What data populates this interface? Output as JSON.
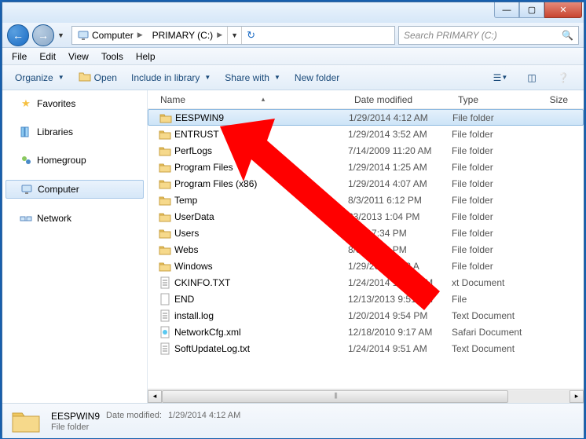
{
  "window_controls": {
    "min": "—",
    "max": "▢",
    "close": "✕"
  },
  "nav": {
    "back": "←",
    "forward": "→"
  },
  "breadcrumbs": [
    "Computer",
    "PRIMARY (C:)"
  ],
  "search": {
    "placeholder": "Search PRIMARY (C:)"
  },
  "menubar": [
    "File",
    "Edit",
    "View",
    "Tools",
    "Help"
  ],
  "toolbar": {
    "organize": "Organize",
    "open": "Open",
    "include": "Include in library",
    "share": "Share with",
    "newfolder": "New folder"
  },
  "sidebar": {
    "favorites": "Favorites",
    "libraries": "Libraries",
    "homegroup": "Homegroup",
    "computer": "Computer",
    "network": "Network"
  },
  "columns": {
    "name": "Name",
    "date": "Date modified",
    "type": "Type",
    "size": "Size"
  },
  "files": [
    {
      "name": "EESPWIN9",
      "date": "1/29/2014 4:12 AM",
      "type": "File folder",
      "icon": "folder",
      "selected": true
    },
    {
      "name": "ENTRUST",
      "date": "1/29/2014 3:52 AM",
      "type": "File folder",
      "icon": "folder"
    },
    {
      "name": "PerfLogs",
      "date": "7/14/2009 11:20 AM",
      "type": "File folder",
      "icon": "folder"
    },
    {
      "name": "Program Files",
      "date": "1/29/2014 1:25 AM",
      "type": "File folder",
      "icon": "folder"
    },
    {
      "name": "Program Files (x86)",
      "date": "1/29/2014 4:07 AM",
      "type": "File folder",
      "icon": "folder"
    },
    {
      "name": "Temp",
      "date": "8/3/2011 6:12 PM",
      "type": "File folder",
      "icon": "folder"
    },
    {
      "name": "UserData",
      "date": "23/2013 1:04 PM",
      "type": "File folder",
      "icon": "folder"
    },
    {
      "name": "Users",
      "date": "1/24/        7:34 PM",
      "type": "File folder",
      "icon": "folder"
    },
    {
      "name": "Webs",
      "date": "8/31/2013        PM",
      "type": "File folder",
      "icon": "folder"
    },
    {
      "name": "Windows",
      "date": "1/29/2014 1:03 A",
      "type": "File folder",
      "icon": "folder"
    },
    {
      "name": "CKINFO.TXT",
      "date": "1/24/2014 10:20 PM",
      "type": "   xt Document",
      "icon": "txt"
    },
    {
      "name": "END",
      "date": "12/13/2013 9:51 PM",
      "type": "File",
      "icon": "file"
    },
    {
      "name": "install.log",
      "date": "1/20/2014 9:54 PM",
      "type": "Text Document",
      "icon": "txt"
    },
    {
      "name": "NetworkCfg.xml",
      "date": "12/18/2010 9:17 AM",
      "type": "Safari Document",
      "icon": "xml"
    },
    {
      "name": "SoftUpdateLog.txt",
      "date": "1/24/2014 9:51 AM",
      "type": "Text Document",
      "icon": "txt"
    }
  ],
  "details": {
    "name": "EESPWIN9",
    "meta_label": "Date modified:",
    "meta_value": "1/29/2014 4:12 AM",
    "type": "File folder"
  }
}
